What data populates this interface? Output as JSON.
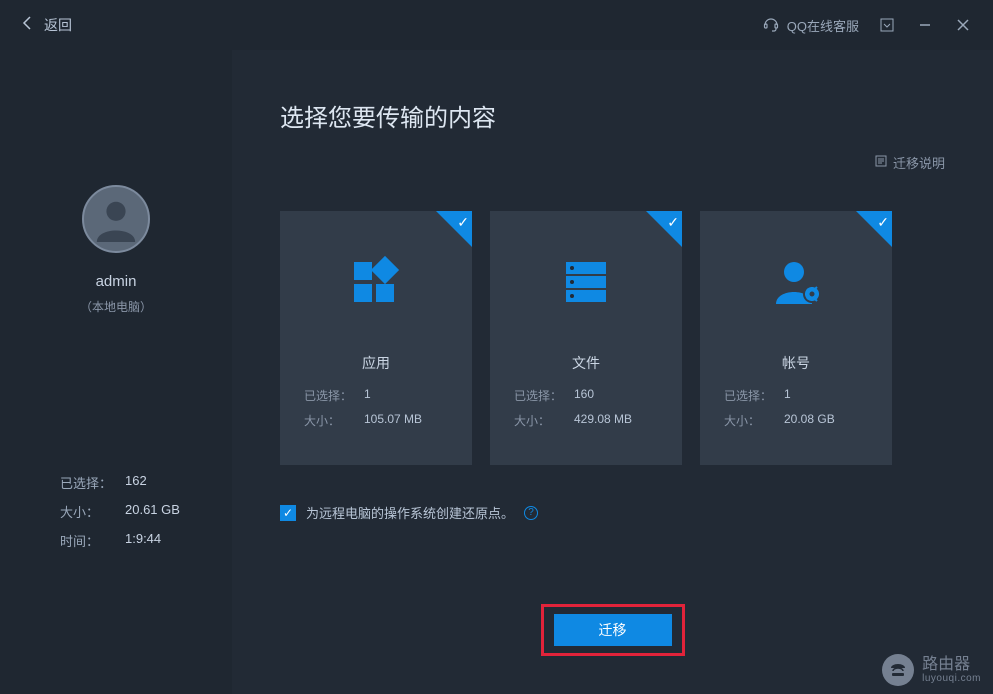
{
  "titlebar": {
    "back_label": "返回",
    "qq_support_label": "QQ在线客服"
  },
  "sidebar": {
    "username": "admin",
    "local_label": "（本地电脑）",
    "stats": {
      "selected_label": "已选择：",
      "selected_value": "162",
      "size_label": "大小：",
      "size_value": "20.61 GB",
      "time_label": "时间：",
      "time_value": "1:9:44"
    }
  },
  "main": {
    "title": "选择您要传输的内容",
    "help_link": "迁移说明",
    "cards": [
      {
        "title": "应用",
        "selected_label": "已选择：",
        "selected_value": "1",
        "size_label": "大小：",
        "size_value": "105.07 MB"
      },
      {
        "title": "文件",
        "selected_label": "已选择：",
        "selected_value": "160",
        "size_label": "大小：",
        "size_value": "429.08 MB"
      },
      {
        "title": "帐号",
        "selected_label": "已选择：",
        "selected_value": "1",
        "size_label": "大小：",
        "size_value": "20.08 GB"
      }
    ],
    "restore_point_label": "为远程电脑的操作系统创建还原点。",
    "migrate_button": "迁移"
  },
  "watermark": {
    "main": "路由器",
    "sub": "luyouqi.com"
  }
}
